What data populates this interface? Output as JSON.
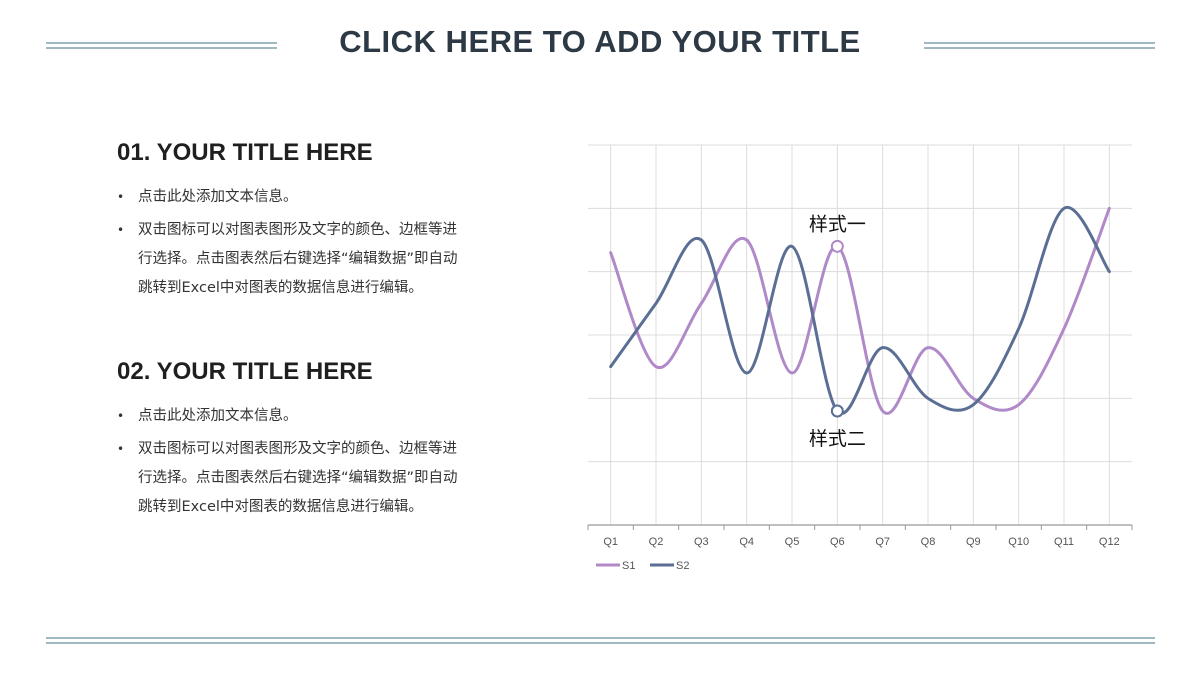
{
  "header": {
    "title": "CLICK HERE TO ADD YOUR TITLE"
  },
  "sections": [
    {
      "title": "01. YOUR TITLE HERE",
      "bullets": [
        "点击此处添加文本信息。",
        "双击图标可以对图表图形及文字的颜色、边框等进行选择。点击图表然后右键选择“编辑数据”即自动跳转到Excel中对图表的数据信息进行编辑。"
      ]
    },
    {
      "title": "02. YOUR TITLE HERE",
      "bullets": [
        "点击此处添加文本信息。",
        "双击图标可以对图表图形及文字的颜色、边框等进行选择。点击图表然后右键选择“编辑数据”即自动跳转到Excel中对图表的数据信息进行编辑。"
      ]
    }
  ],
  "colors": {
    "accent_line": "#9fb8c2",
    "title": "#2d3a45",
    "s1": "#b089c8",
    "s2": "#5b6e93"
  },
  "chart_data": {
    "type": "line",
    "smooth": true,
    "categories": [
      "Q1",
      "Q2",
      "Q3",
      "Q4",
      "Q5",
      "Q6",
      "Q7",
      "Q8",
      "Q9",
      "Q10",
      "Q11",
      "Q12"
    ],
    "series": [
      {
        "name": "S1",
        "color": "#b089c8",
        "values": [
          4.3,
          2.5,
          3.5,
          4.5,
          2.4,
          4.4,
          1.8,
          2.8,
          2.0,
          1.9,
          3.1,
          5.0
        ]
      },
      {
        "name": "S2",
        "color": "#5b6e93",
        "values": [
          2.5,
          3.5,
          4.5,
          2.4,
          4.4,
          1.8,
          2.8,
          2.0,
          1.9,
          3.1,
          5.0,
          4.0
        ]
      }
    ],
    "ylim": [
      0,
      6
    ],
    "y_axis_labels": false,
    "grid": true,
    "legend": "bottom-left",
    "annotations": [
      {
        "text": "样式一",
        "series": "S1",
        "category": "Q6",
        "position": "above"
      },
      {
        "text": "样式二",
        "series": "S2",
        "category": "Q6",
        "position": "below"
      }
    ]
  }
}
